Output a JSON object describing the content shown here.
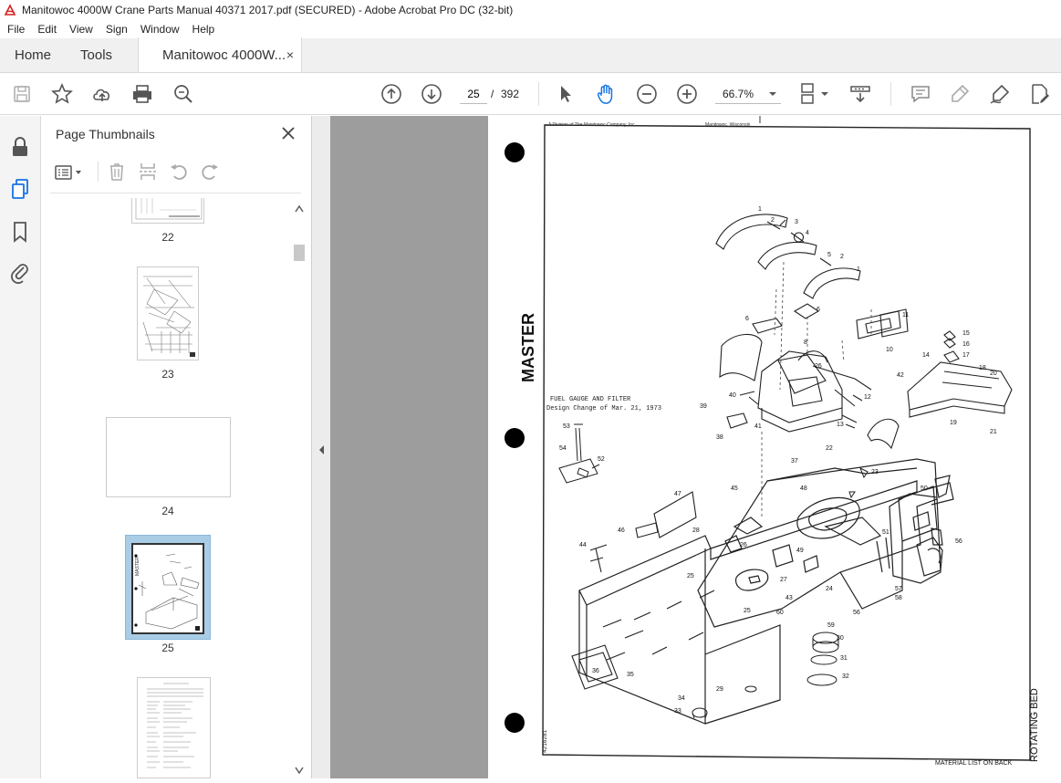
{
  "window": {
    "title": "Manitowoc 4000W Crane Parts Manual 40371 2017.pdf (SECURED) - Adobe Acrobat Pro DC (32-bit)"
  },
  "menu": [
    "File",
    "Edit",
    "View",
    "Sign",
    "Window",
    "Help"
  ],
  "tabs": {
    "home": "Home",
    "tools": "Tools",
    "document": "Manitowoc 4000W...",
    "document_close": "×"
  },
  "toolbar": {
    "page_current": "25",
    "page_separator": "/",
    "page_total": "392",
    "zoom": "66.7%"
  },
  "panel": {
    "title": "Page Thumbnails",
    "thumbnails": [
      {
        "label": "22"
      },
      {
        "label": "23"
      },
      {
        "label": "24"
      },
      {
        "label": "25",
        "selected": true
      },
      {
        "label": ""
      }
    ]
  },
  "document_page": {
    "header_left": "A Division of The Manitowoc Company, Inc.",
    "header_right": "Manitowoc, Wisconsin",
    "stamp": "MASTER",
    "note_line1": "FUEL GAUGE AND FILTER",
    "note_line2": "Design Change of Mar. 21, 1973",
    "footer": "MATERIAL LIST ON BACK",
    "side_title": "ROTATING BED",
    "doc_number": "4216281",
    "callouts": [
      "1",
      "2",
      "3",
      "4",
      "5",
      "2",
      "1",
      "6",
      "6",
      "11",
      "10",
      "8",
      "26",
      "42",
      "14",
      "15",
      "16",
      "17",
      "18",
      "20",
      "19",
      "21",
      "40",
      "39",
      "12",
      "41",
      "38",
      "13",
      "53",
      "54",
      "52",
      "22",
      "37",
      "23",
      "47",
      "45",
      "48",
      "50",
      "46",
      "28",
      "51",
      "44",
      "26",
      "25",
      "49",
      "56",
      "27",
      "24",
      "57",
      "58",
      "43",
      "25",
      "60",
      "59",
      "56",
      "30",
      "31",
      "32",
      "36",
      "35",
      "29",
      "34",
      "33"
    ]
  },
  "colors": {
    "selection": "#a9cde6",
    "canvas": "#9d9d9d",
    "accent": "#1473e6"
  }
}
